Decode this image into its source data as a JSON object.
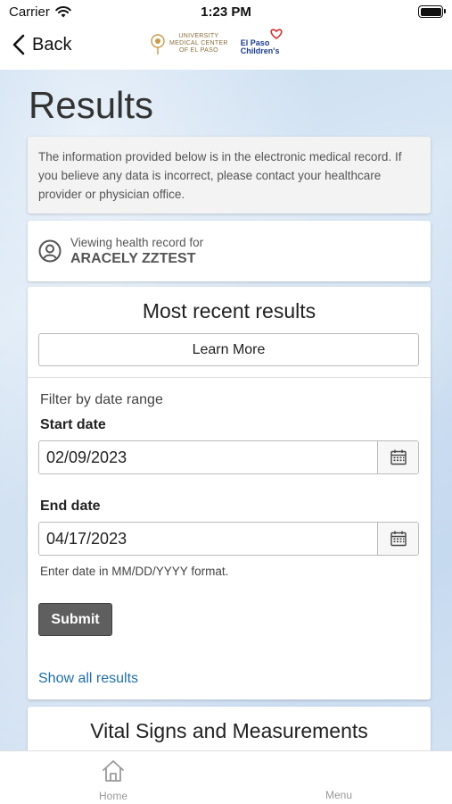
{
  "status_bar": {
    "carrier": "Carrier",
    "time": "1:23 PM"
  },
  "nav": {
    "back_label": "Back",
    "logo_umc_lines": [
      "UNIVERSITY",
      "MEDICAL CENTER",
      "OF EL PASO"
    ],
    "logo_ep_lines": [
      "El Paso",
      "Children's"
    ]
  },
  "page": {
    "title": "Results"
  },
  "info": {
    "text": "The information provided below is in the electronic medical record. If you believe any data is incorrect, please contact your healthcare provider or physician office."
  },
  "viewing": {
    "label": "Viewing health record for",
    "name": "ARACELY ZZTEST"
  },
  "results": {
    "title": "Most recent results",
    "learn_more": "Learn More",
    "filter_label": "Filter by date range",
    "start_label": "Start date",
    "start_value": "02/09/2023",
    "end_label": "End date",
    "end_value": "04/17/2023",
    "hint": "Enter date in MM/DD/YYYY format.",
    "submit": "Submit",
    "show_all": "Show all results"
  },
  "vitals": {
    "title": "Vital Signs and Measurements"
  },
  "tabs": {
    "home": "Home",
    "menu": "Menu"
  },
  "colors": {
    "link": "#1f6fa8",
    "submit_bg": "#5f5f5f"
  }
}
